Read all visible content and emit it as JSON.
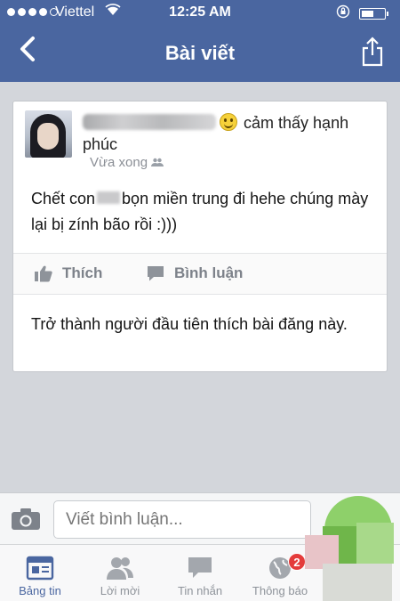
{
  "status_bar": {
    "carrier": "Viettel",
    "time": "12:25 AM",
    "signal_bars": 4
  },
  "nav": {
    "title": "Bài viết",
    "back_icon": "chevron-left-icon",
    "share_icon": "share-icon"
  },
  "post": {
    "author_suffix": "cảm thấy hạnh phúc",
    "timestamp": "Vừa xong",
    "text_before": "Chết con",
    "text_after": "bọn miền trung đi hehe chúng mày lại bị zính bão rồi :)))",
    "like_label": "Thích",
    "comment_label": "Bình luận",
    "first_like_text": "Trở thành người đầu tiên thích bài đăng này."
  },
  "comment_input": {
    "placeholder": "Viết bình luận..."
  },
  "tabs": [
    {
      "label": "Bảng tin",
      "icon": "news-feed-icon",
      "active": true
    },
    {
      "label": "Lời mời",
      "icon": "friend-requests-icon",
      "active": false
    },
    {
      "label": "Tin nhắn",
      "icon": "messages-icon",
      "active": false
    },
    {
      "label": "Thông báo",
      "icon": "globe-icon",
      "active": false,
      "badge": "2"
    }
  ],
  "colors": {
    "brand": "#4a66a0",
    "background": "#d3d6db",
    "badge": "#e43b3b"
  }
}
